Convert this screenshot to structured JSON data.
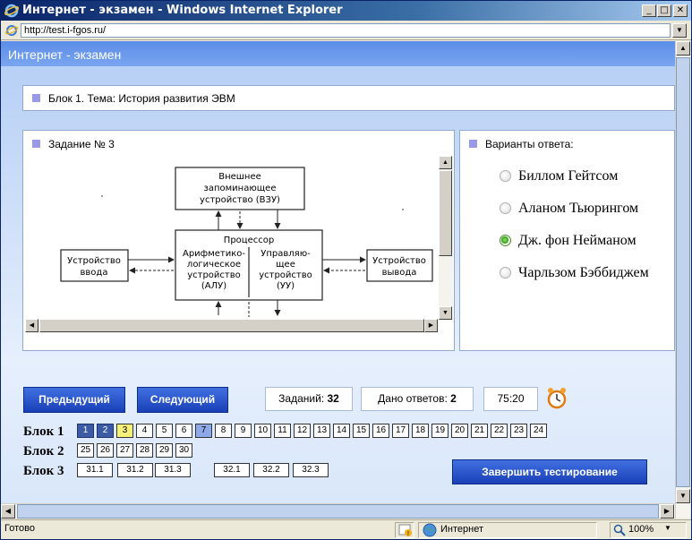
{
  "window": {
    "title": "Интернет - экзамен - Windows Internet Explorer",
    "minimize": "_",
    "maximize": "□",
    "close": "✕"
  },
  "address": {
    "url": "http://test.i-fgos.ru/"
  },
  "page": {
    "header": "Интернет - экзамен",
    "block_title": "Блок 1. Тема: История развития ЭВМ",
    "task_title": "Задание № 3",
    "diagram": {
      "vzu": [
        "Внешнее",
        "запоминающее",
        "устройство (ВЗУ)"
      ],
      "processor": "Процессор",
      "alu": [
        "Арифметико-",
        "логическое",
        "устройство",
        "(АЛУ)"
      ],
      "uu": [
        "Управляю-",
        "щее",
        "устройство",
        "(УУ)"
      ],
      "input": [
        "Устройство",
        "ввода"
      ],
      "output": [
        "Устройство",
        "вывода"
      ]
    },
    "answers_title": "Варианты ответа:",
    "answers": [
      {
        "label": "Биллом Гейтсом",
        "selected": false
      },
      {
        "label": "Аланом Тьюрингом",
        "selected": false
      },
      {
        "label": "Дж. фон Нейманом",
        "selected": true
      },
      {
        "label": "Чарльзом Бэббиджем",
        "selected": false
      }
    ],
    "prev_button": "Предыдущий",
    "next_button": "Следующий",
    "tasks_label": "Заданий:",
    "tasks_count": "32",
    "answered_label": "Дано ответов:",
    "answered_count": "2",
    "timer": "75:20",
    "finish_button": "Завершить тестирование",
    "blocks": [
      {
        "label": "Блок 1",
        "items": [
          "1",
          "2",
          "3",
          "4",
          "5",
          "6",
          "7",
          "8",
          "9",
          "10",
          "11",
          "12",
          "13",
          "14",
          "15",
          "16",
          "17",
          "18",
          "19",
          "20",
          "21",
          "22",
          "23",
          "24"
        ]
      },
      {
        "label": "Блок 2",
        "items": [
          "25",
          "26",
          "27",
          "28",
          "29",
          "30"
        ]
      },
      {
        "label": "Блок 3",
        "items": [
          "31.1",
          "31.2",
          "31.3",
          "32.1",
          "32.2",
          "32.3"
        ]
      }
    ]
  },
  "status": {
    "ready": "Готово",
    "zone": "Интернет",
    "zoom": "100%"
  },
  "colors": {
    "answered": "#3B5BA5",
    "current": "#F5F07A",
    "viewed": "#8FA8E8",
    "accent": "#1A40B8"
  }
}
